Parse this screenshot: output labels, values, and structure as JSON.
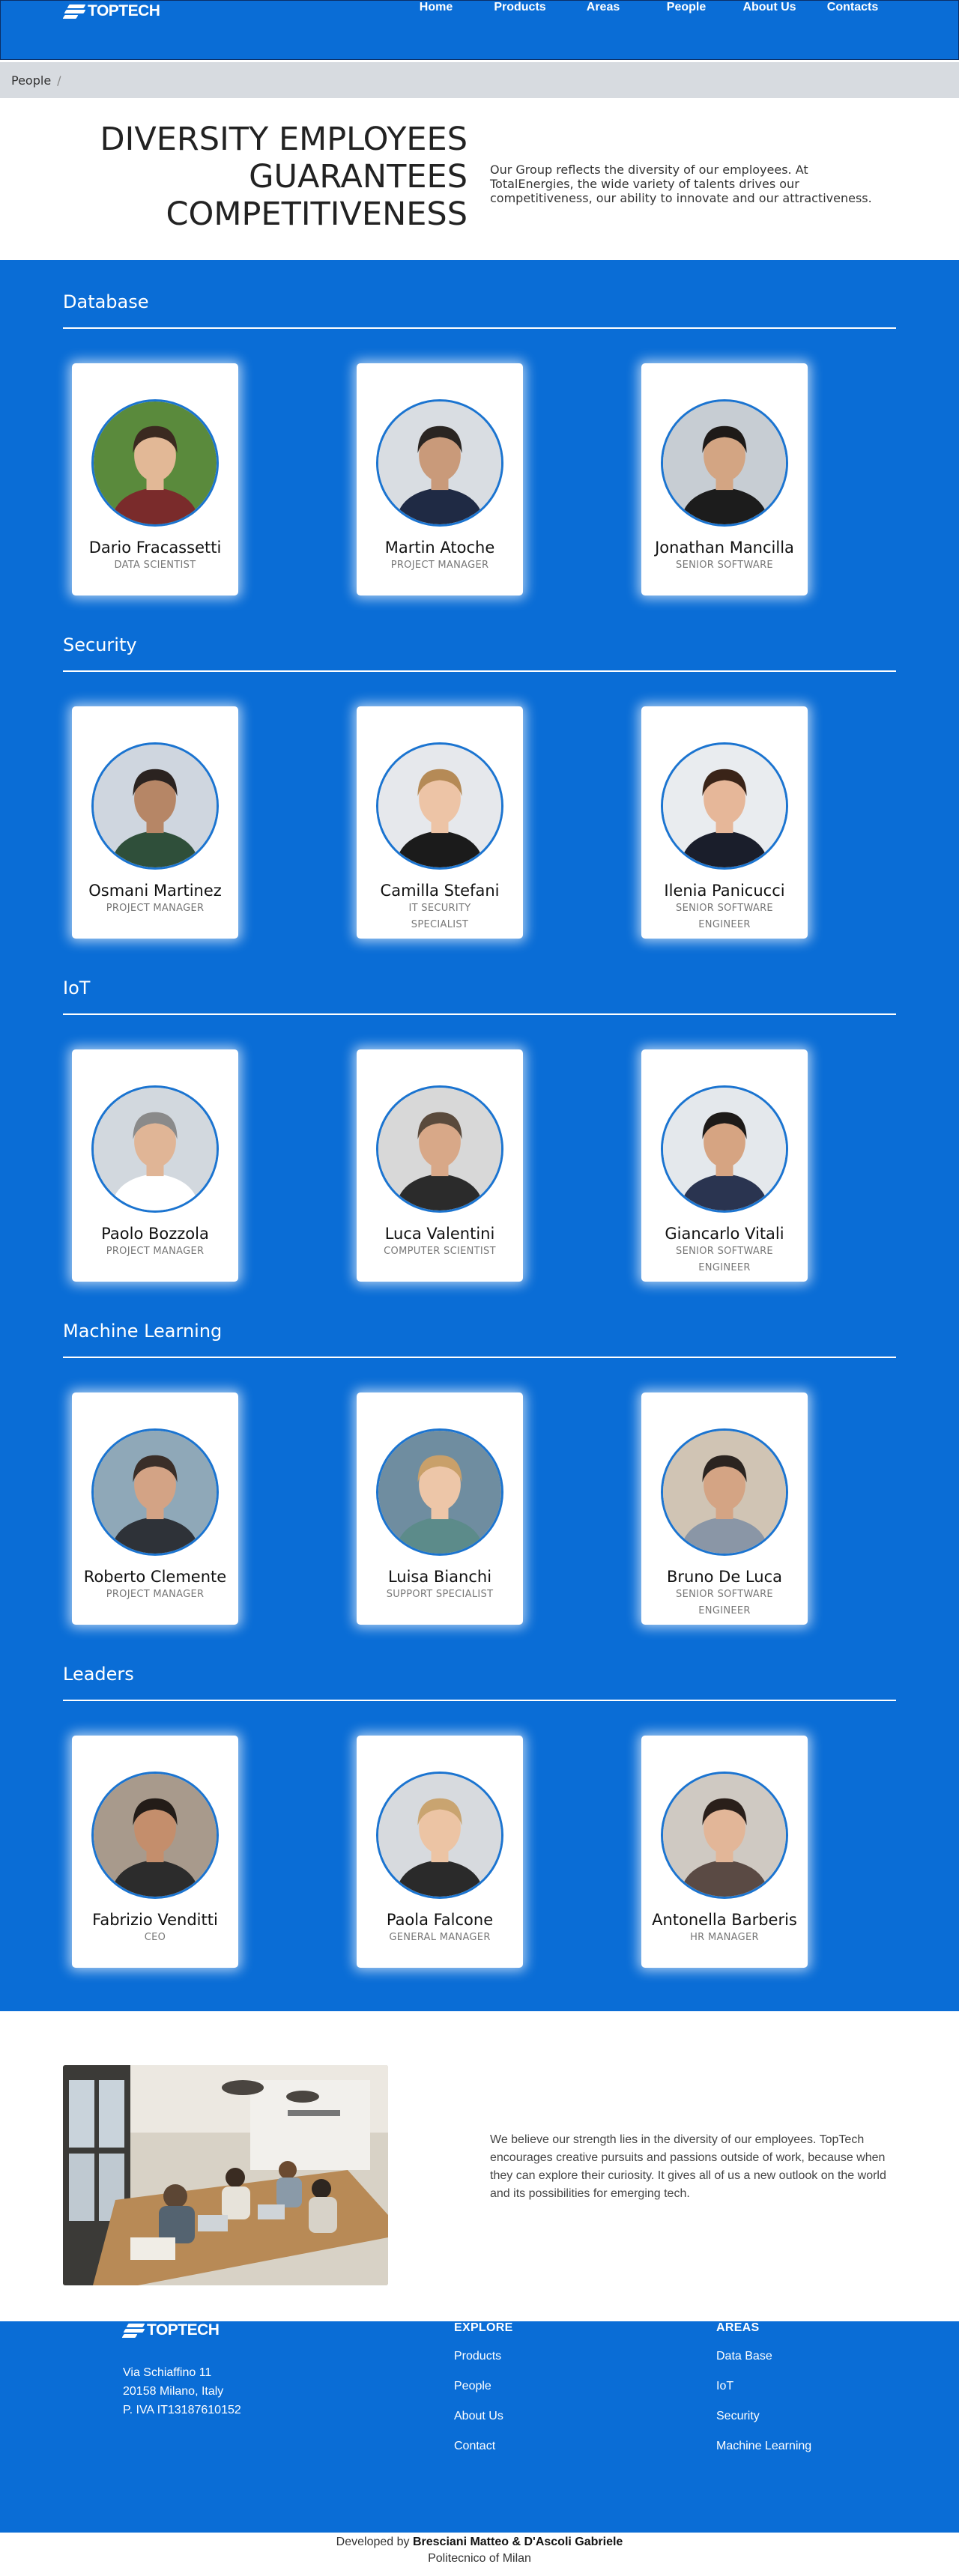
{
  "navbar": {
    "brand": "TOPTECH",
    "links": [
      "Home",
      "Products",
      "Areas",
      "People",
      "About Us",
      "Contacts"
    ]
  },
  "breadcrumb": {
    "current": "People",
    "separator": "/"
  },
  "hero": {
    "title_line1": "DIVERSITY EMPLOYEES",
    "title_line2": "GUARANTEES",
    "title_line3": "COMPETITIVENESS",
    "text": "Our Group reflects the diversity of our employees. At TotalEnergies, the wide variety of talents drives our competitiveness, our ability to innovate and our attractiveness."
  },
  "teams": [
    {
      "title": "Database",
      "members": [
        {
          "name": "Dario Fracassetti",
          "role": "DATA SCIENTIST"
        },
        {
          "name": "Martin Atoche",
          "role": "PROJECT MANAGER"
        },
        {
          "name": "Jonathan Mancilla",
          "role": "SENIOR SOFTWARE"
        }
      ]
    },
    {
      "title": "Security",
      "members": [
        {
          "name": "Osmani Martinez",
          "role": "PROJECT MANAGER"
        },
        {
          "name": "Camilla Stefani",
          "role": "IT SECURITY SPECIALIST"
        },
        {
          "name": "Ilenia Panicucci",
          "role": "SENIOR SOFTWARE ENGINEER"
        }
      ]
    },
    {
      "title": "IoT",
      "members": [
        {
          "name": "Paolo Bozzola",
          "role": "PROJECT MANAGER"
        },
        {
          "name": "Luca Valentini",
          "role": "COMPUTER SCIENTIST"
        },
        {
          "name": "Giancarlo Vitali",
          "role": "SENIOR SOFTWARE ENGINEER"
        }
      ]
    },
    {
      "title": "Machine Learning",
      "members": [
        {
          "name": "Roberto Clemente",
          "role": "PROJECT MANAGER"
        },
        {
          "name": "Luisa Bianchi",
          "role": "SUPPORT SPECIALIST"
        },
        {
          "name": "Bruno De Luca",
          "role": "SENIOR SOFTWARE ENGINEER"
        }
      ]
    },
    {
      "title": "Leaders",
      "members": [
        {
          "name": "Fabrizio Venditti",
          "role": "CEO"
        },
        {
          "name": "Paola Falcone",
          "role": "GENERAL MANAGER"
        },
        {
          "name": "Antonella Barberis",
          "role": "HR MANAGER"
        }
      ]
    }
  ],
  "about": {
    "text": "We believe our strength lies in the diversity of our employees. TopTech encourages creative pursuits and passions outside of work, because when they can explore their curiosity. It gives all of us a new outlook on the world and its possibilities for emerging tech."
  },
  "footer": {
    "brand": "TOPTECH",
    "address": [
      "Via Schiaffino 11",
      "20158 Milano, Italy",
      "P. IVA IT13187610152"
    ],
    "explore": {
      "title": "EXPLORE",
      "links": [
        "Products",
        "People",
        "About Us",
        "Contact"
      ]
    },
    "areas": {
      "title": "AREAS",
      "links": [
        "Data Base",
        "IoT",
        "Security",
        "Machine Learning"
      ]
    }
  },
  "credits": {
    "developed_prefix": "Developed by",
    "developers": "Bresciani Matteo & D'Ascoli Gabriele",
    "institution": "Politecnico of Milan"
  },
  "colors": {
    "primary": "#0a6dd6",
    "breadcrumb_bg": "#d7dbe0",
    "navbar_border": "#0b2f66"
  },
  "icons": {
    "brand": "toptech-logo-mark"
  }
}
